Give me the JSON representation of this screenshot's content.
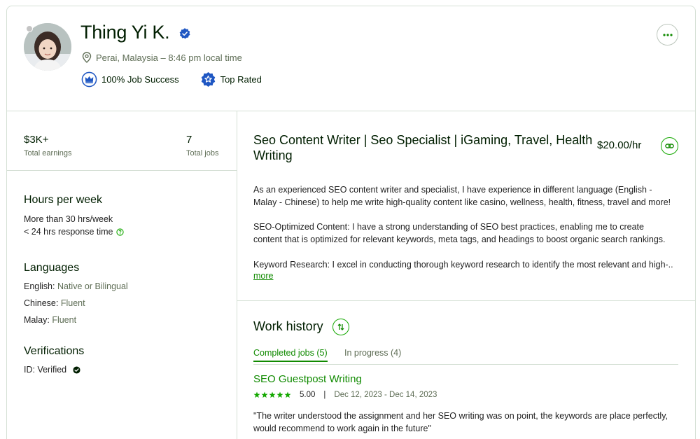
{
  "profile": {
    "name": "Thing Yi K.",
    "location": "Perai, Malaysia – 8:46 pm local time",
    "badges": {
      "job_success": "100% Job Success",
      "top_rated": "Top Rated"
    }
  },
  "stats": {
    "total_earnings": {
      "value": "$3K+",
      "label": "Total earnings"
    },
    "total_jobs": {
      "value": "7",
      "label": "Total jobs"
    }
  },
  "hours": {
    "title": "Hours per week",
    "availability": "More than 30 hrs/week",
    "response": "< 24 hrs response time"
  },
  "languages": {
    "title": "Languages",
    "items": [
      {
        "name": "English:",
        "level": "Native or Bilingual"
      },
      {
        "name": "Chinese:",
        "level": "Fluent"
      },
      {
        "name": "Malay:",
        "level": "Fluent"
      }
    ]
  },
  "verifications": {
    "title": "Verifications",
    "id_label": "ID: Verified"
  },
  "about": {
    "title": "Seo Content Writer | Seo Specialist | iGaming, Travel, Health Writing",
    "rate": "$20.00/hr",
    "paragraphs": [
      "As an experienced SEO content writer and specialist, I have experience in different language (English - Malay - Chinese) to help me write high-quality content like casino, wellness, health, fitness, travel and more!",
      "SEO-Optimized Content: I have a strong understanding of SEO best practices, enabling me to create content that is optimized for relevant keywords, meta tags, and headings to boost organic search rankings.",
      "Keyword Research: I excel in conducting thorough keyword research to identify the most relevant and high-..."
    ],
    "more_label": "more"
  },
  "work_history": {
    "title": "Work history",
    "tabs": [
      "Completed jobs (5)",
      "In progress (4)"
    ],
    "jobs": [
      {
        "title": "SEO Guestpost Writing",
        "rating": "5.00",
        "rating_value": 5,
        "separator": "|",
        "dates": "Dec 12, 2023 - Dec 14, 2023",
        "review": "\"The writer understood the assignment and her SEO writing was on point, the keywords are place perfectly, would recommend to work again in the future\""
      }
    ]
  },
  "colors": {
    "brand_green": "#108a00",
    "badge_blue": "#1f57c3",
    "text_dark": "#001e00",
    "muted": "#5e6d55",
    "border": "#d5e0d5"
  }
}
